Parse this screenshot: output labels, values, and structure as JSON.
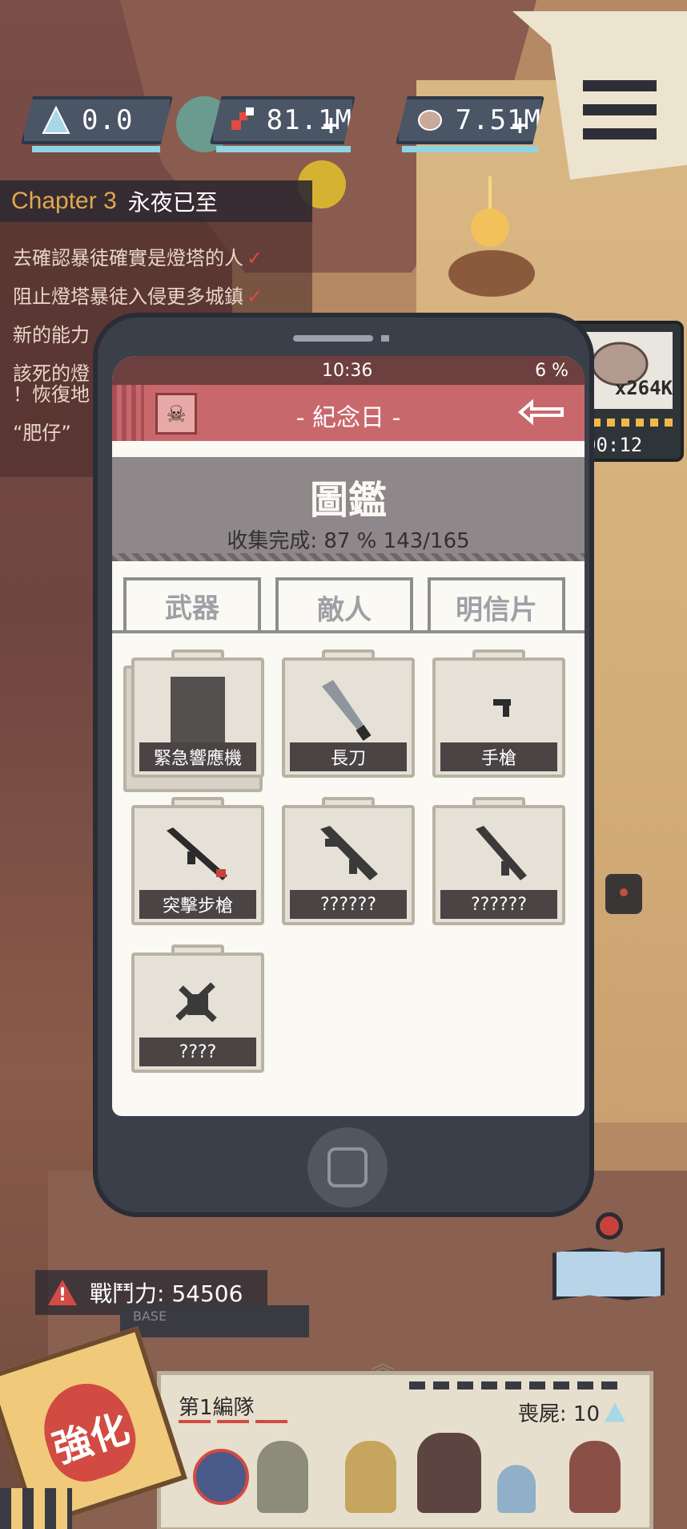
{
  "hud": {
    "crystal": {
      "icon": "crystal-icon",
      "value": "0.0"
    },
    "gems": {
      "icon": "gem-icon",
      "value": "81.1M",
      "plus": "+"
    },
    "food": {
      "icon": "meat-icon",
      "value": "7.51M",
      "plus": "+"
    },
    "menu_icon": "menu-icon"
  },
  "quest": {
    "chapter_label": "Chapter 3",
    "chapter_name": "永夜已至",
    "items": [
      {
        "text": "去確認暴徒確實是燈塔的人",
        "check": "✓"
      },
      {
        "text": "阻止燈塔暴徒入侵更多城鎮",
        "check": "✓"
      },
      {
        "text": "新的能力"
      },
      {
        "text": "該死的燈"
      },
      {
        "text": "！恢復地"
      },
      {
        "text": "“肥仔”"
      }
    ]
  },
  "phone": {
    "status": {
      "time": "10:36",
      "battery": "6 %"
    },
    "title": "- 紀念日 -",
    "back_icon": "back-arrow-icon",
    "gallery": {
      "title": "圖鑑",
      "progress": "收集完成: 87 % 143/165"
    },
    "tabs": [
      "武器",
      "敵人",
      "明信片"
    ],
    "cards": [
      {
        "label": "緊急響應機",
        "icon": "device-icon"
      },
      {
        "label": "長刀",
        "icon": "machete-icon"
      },
      {
        "label": "手槍",
        "icon": "pistol-icon"
      },
      {
        "label": "突擊步槍",
        "icon": "assault-rifle-icon"
      },
      {
        "label": "??????",
        "icon": "unknown-rifle-icon"
      },
      {
        "label": "??????",
        "icon": "unknown-rifle-icon"
      },
      {
        "label": "????",
        "icon": "unknown-wrench-icon"
      }
    ]
  },
  "reward": {
    "amount": "x264K",
    "timer": "00:12"
  },
  "power": {
    "label": "戰鬥力: 54506"
  },
  "base_label": "BASE",
  "squad": {
    "name": "第1編隊",
    "zombie_count": "喪屍: 10"
  },
  "enhance": {
    "label": "強化"
  },
  "colors": {
    "accent_red": "#d14b42",
    "phone_body": "#3b3f49",
    "title_bar": "#c9686c",
    "chapter_gold": "#e2a84c"
  }
}
